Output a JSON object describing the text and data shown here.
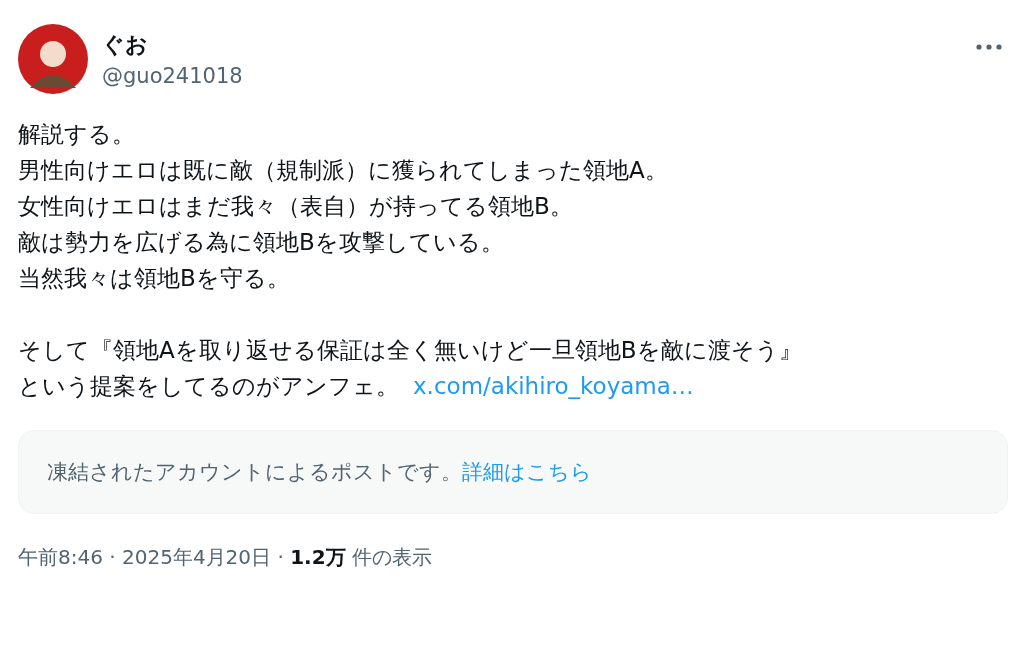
{
  "author": {
    "name": "ぐお",
    "handle": "@guo241018"
  },
  "paragraphs": [
    [
      "解説する。",
      "男性向けエロは既に敵（規制派）に獲られてしまった領地A。",
      "女性向けエロはまだ我々（表自）が持ってる領地B。",
      "敵は勢力を広げる為に領地Bを攻撃している。",
      "当然我々は領地Bを守る。"
    ],
    [
      "そして『領地Aを取り返せる保証は全く無いけど一旦領地Bを敵に渡そう』",
      "という提案をしてるのがアンフェ。"
    ]
  ],
  "link": "x.com/akihiro_koyama…",
  "notice": {
    "text": "凍結されたアカウントによるポストです。",
    "link": "詳細はこちら"
  },
  "meta": "午前8:46 · 2025年4月20日 · **1.2万** 件の表示"
}
